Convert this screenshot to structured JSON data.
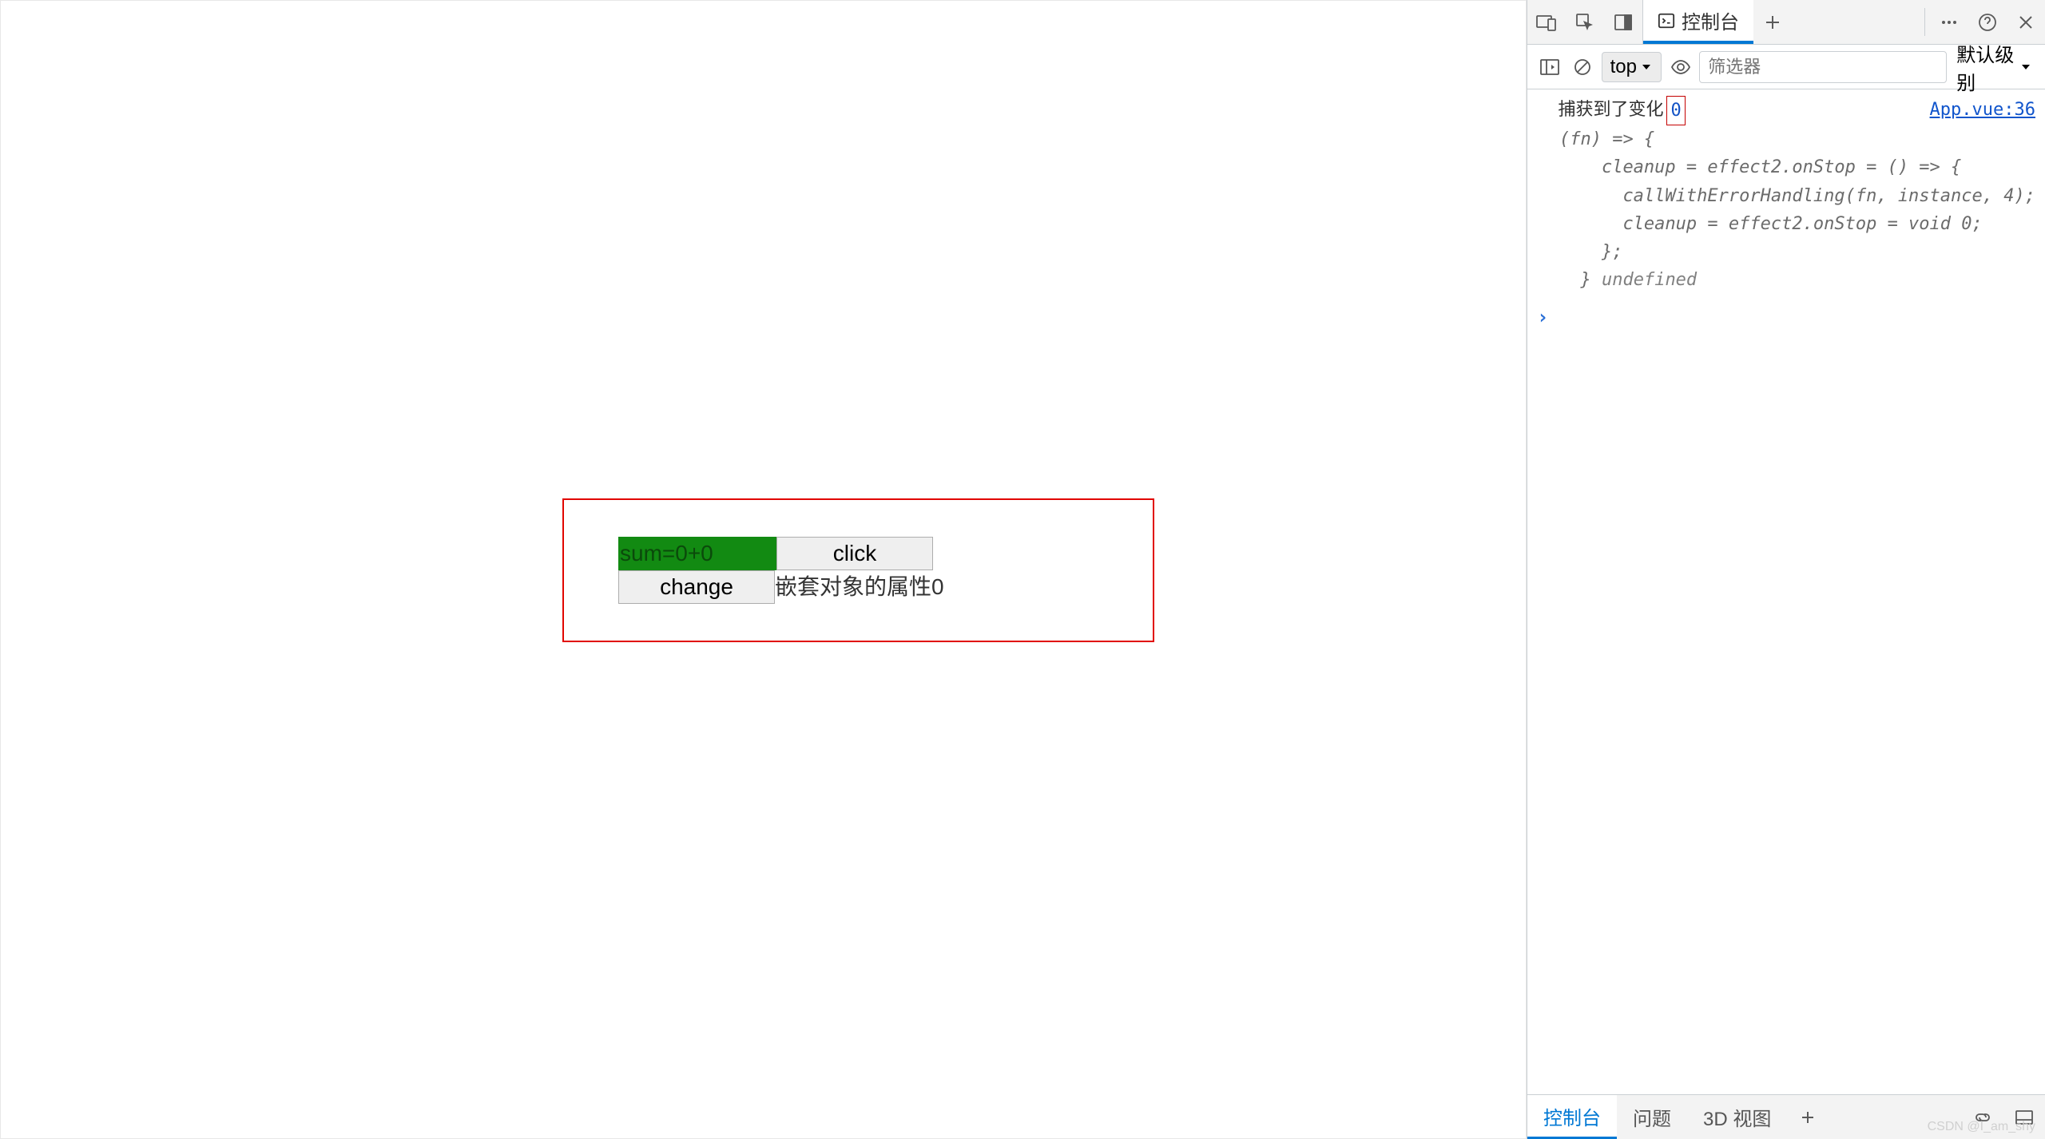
{
  "page": {
    "sum_text": "sum=0+0",
    "click_btn": "click",
    "change_btn": "change",
    "nested_text": "嵌套对象的属性0"
  },
  "devtools": {
    "tabs": {
      "console": "控制台"
    },
    "toolbar": {
      "context": "top",
      "filter_placeholder": "筛选器",
      "level": "默认级别"
    },
    "log": {
      "message": "  捕获到了变化",
      "value": "0",
      "source": "App.vue:36",
      "fn_line1": "(fn) => {",
      "fn_line2": "    cleanup = effect2.onStop = () => {",
      "fn_line3": "      callWithErrorHandling(fn, instance, 4);",
      "fn_line4": "      cleanup = effect2.onStop = void 0;",
      "fn_line5": "    };",
      "fn_line6": "  }",
      "trailing": "undefined"
    },
    "drawer": {
      "tabs": [
        "控制台",
        "问题",
        "3D 视图"
      ]
    }
  },
  "watermark": "CSDN @I_am_shy"
}
